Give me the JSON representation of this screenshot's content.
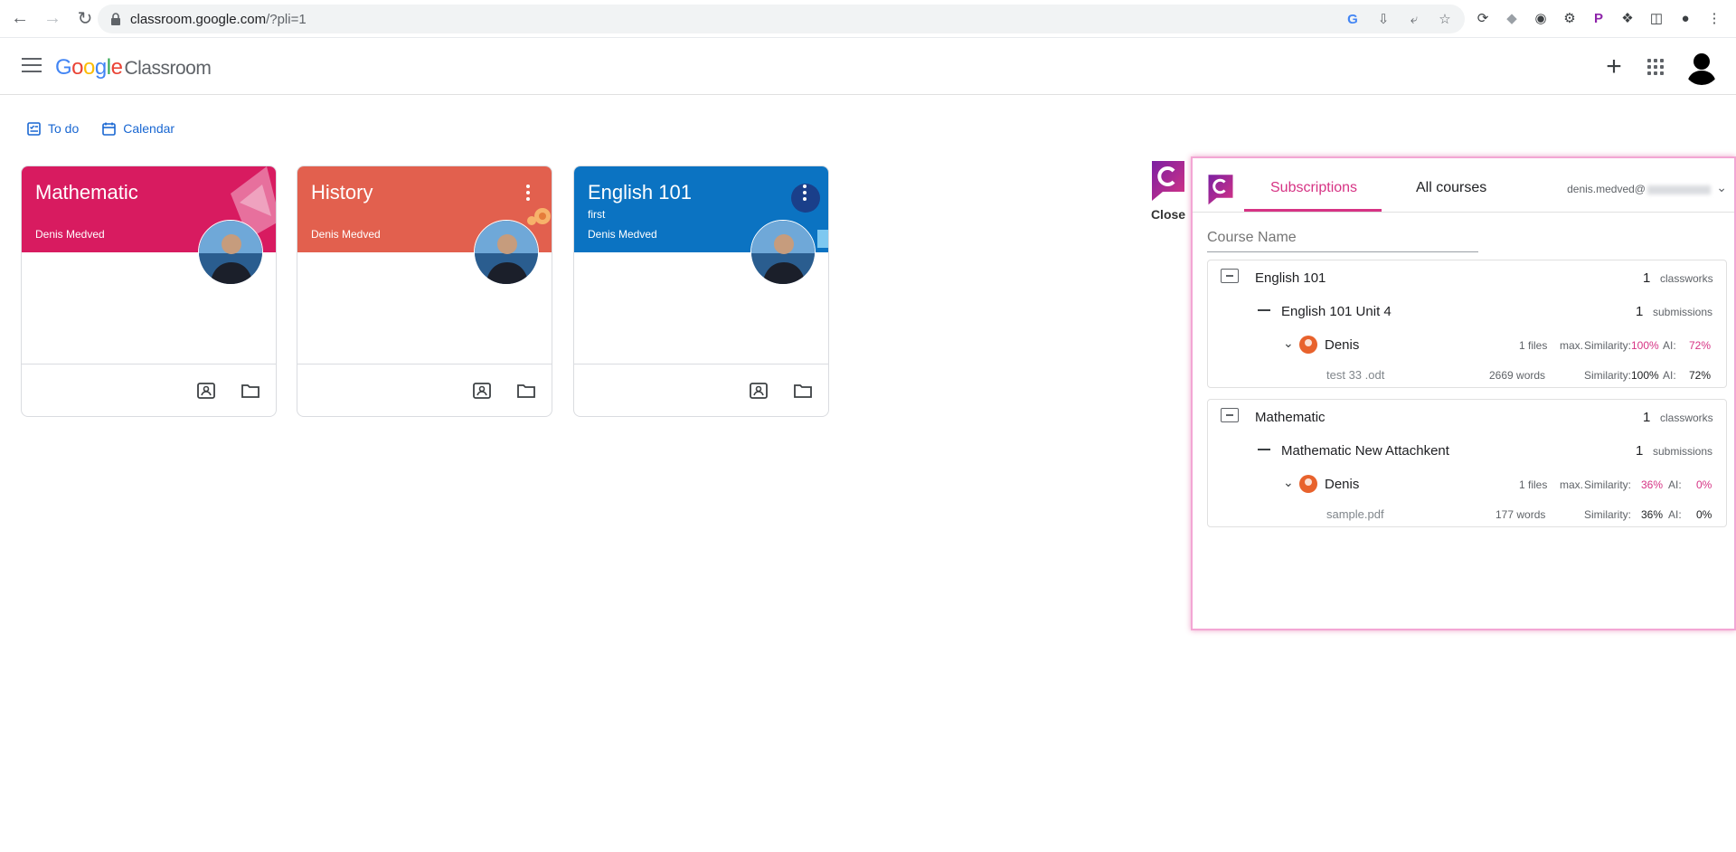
{
  "browser": {
    "url_host": "classroom.google.com",
    "url_path": "/?pli=1"
  },
  "header": {
    "logo_g": "Google",
    "logo_product": "Classroom"
  },
  "quicklinks": {
    "todo": "To do",
    "calendar": "Calendar"
  },
  "cards": [
    {
      "title": "Mathematic",
      "section": "",
      "teacher": "Denis Medved",
      "color": "#d81b60"
    },
    {
      "title": "History",
      "section": "",
      "teacher": "Denis Medved",
      "color": "#e2604e"
    },
    {
      "title": "English 101",
      "section": "first",
      "teacher": "Denis Medved",
      "color": "#0b73c2"
    }
  ],
  "extension": {
    "close_label": "Close",
    "tab_subscriptions": "Subscriptions",
    "tab_all_courses": "All courses",
    "email": "denis.medved@",
    "search_placeholder": "Course Name",
    "accent_color": "#d63384",
    "courses": [
      {
        "name": "English 101",
        "count": "1",
        "count_unit": "classworks",
        "assignment": "English 101 Unit 4",
        "assignment_count": "1",
        "assignment_unit": "submissions",
        "student": "Denis",
        "files": "1 files",
        "max": "max.",
        "sim_label": "Similarity:",
        "sim_max": "100%",
        "ai_label": "AI:",
        "ai_max": "72%",
        "file_name": "test 33 .odt",
        "words": "2669 words",
        "sim_file": "100%",
        "ai_file": "72%"
      },
      {
        "name": "Mathematic",
        "count": "1",
        "count_unit": "classworks",
        "assignment": "Mathematic New Attachkent",
        "assignment_count": "1",
        "assignment_unit": "submissions",
        "student": "Denis",
        "files": "1 files",
        "max": "max.",
        "sim_label": "Similarity:",
        "sim_max": "36%",
        "ai_label": "AI:",
        "ai_max": "0%",
        "file_name": "sample.pdf",
        "words": "177 words",
        "sim_file": "36%",
        "ai_file": "0%"
      }
    ]
  }
}
